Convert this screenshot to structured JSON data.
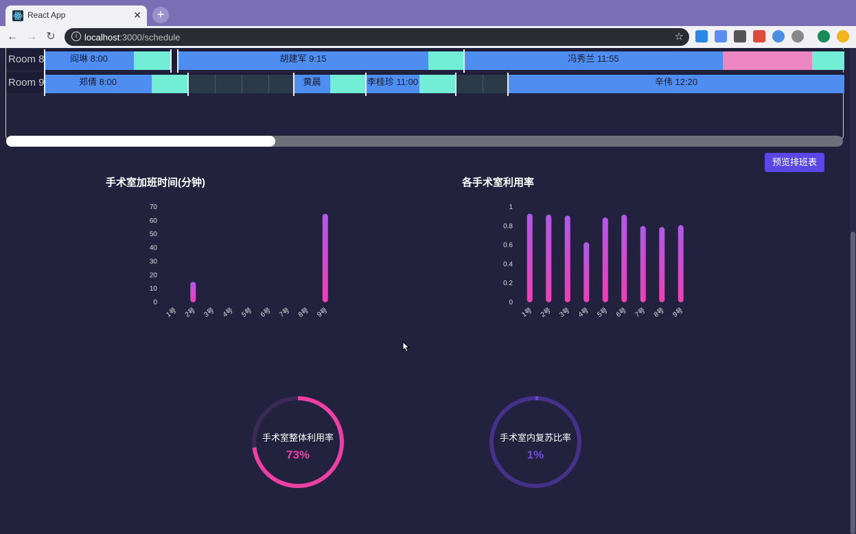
{
  "browser": {
    "tab_title": "React App",
    "url_host": "localhost",
    "url_path": ":3000/schedule",
    "extensions": [
      "new-ext-icon",
      "translate-icon",
      "editor-ext-icon",
      "chrome-ext-icon",
      "blue-ext-icon",
      "gray-ext-icon",
      "profile-avatar-icon",
      "gold-ext-icon"
    ]
  },
  "schedule": {
    "rows": [
      {
        "room": "Room 8",
        "segments": [
          {
            "label": "阎琳 8:00",
            "type": "surgery"
          },
          {
            "label": "",
            "type": "recovery"
          },
          {
            "label": "胡建军 9:15",
            "type": "surgery"
          },
          {
            "label": "",
            "type": "recovery"
          },
          {
            "label": "冯秀兰 11:55",
            "type": "surgery"
          },
          {
            "label": "",
            "type": "overtime"
          },
          {
            "label": "",
            "type": "recovery"
          }
        ]
      },
      {
        "room": "Room 9",
        "segments": [
          {
            "label": "郑倩 8:00",
            "type": "surgery"
          },
          {
            "label": "",
            "type": "recovery"
          },
          {
            "label": "",
            "type": "idle"
          },
          {
            "label": "黄晨",
            "type": "surgery"
          },
          {
            "label": "",
            "type": "recovery"
          },
          {
            "label": "李桂珍 11:00",
            "type": "surgery"
          },
          {
            "label": "",
            "type": "recovery"
          },
          {
            "label": "",
            "type": "idle"
          },
          {
            "label": "辛伟 12:20",
            "type": "surgery"
          }
        ]
      }
    ],
    "colors": {
      "surgery": "#4e8ef0",
      "recovery": "#72edd6",
      "overtime": "#ed87c4",
      "idle": "#2a3a4a"
    }
  },
  "actions": {
    "preview_button": "预览排班表"
  },
  "chart_data": [
    {
      "type": "bar",
      "title": "手术室加班时间(分钟)",
      "categories": [
        "1号",
        "2号",
        "3号",
        "4号",
        "5号",
        "6号",
        "7号",
        "8号",
        "9号"
      ],
      "values": [
        0,
        15,
        0,
        0,
        0,
        0,
        0,
        0,
        65
      ],
      "ylim": [
        0,
        70
      ],
      "yticks": [
        0,
        10,
        20,
        30,
        40,
        50,
        60,
        70
      ],
      "grid": false
    },
    {
      "type": "bar",
      "title": "各手术室利用率",
      "categories": [
        "1号",
        "2号",
        "3号",
        "4号",
        "5号",
        "6号",
        "7号",
        "8号",
        "9号"
      ],
      "values": [
        0.93,
        0.92,
        0.91,
        0.63,
        0.89,
        0.92,
        0.8,
        0.79,
        0.81
      ],
      "ylim": [
        0,
        1
      ],
      "yticks": [
        0,
        0.2,
        0.4,
        0.6,
        0.8,
        1
      ],
      "grid": false
    }
  ],
  "gauges": [
    {
      "label": "手术室整体利用率",
      "value_text": "73%",
      "value": 0.73,
      "color": "#ee3fa5"
    },
    {
      "label": "手术室内复苏比率",
      "value_text": "1%",
      "value": 0.01,
      "color": "#7048d8"
    }
  ]
}
